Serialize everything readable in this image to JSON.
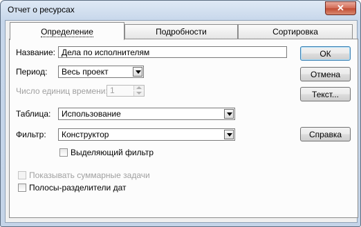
{
  "window": {
    "title": "Отчет о ресурсах",
    "close_glyph": "✕"
  },
  "tabs": [
    {
      "label": "Определение",
      "active": true
    },
    {
      "label": "Подробности",
      "active": false
    },
    {
      "label": "Сортировка",
      "active": false
    }
  ],
  "form": {
    "name_label": "Название:",
    "name_value": "Дела по исполнителям",
    "period_label": "Период:",
    "period_value": "Весь проект",
    "units_label": "Число единиц времени:",
    "units_value": "1",
    "table_label": "Таблица:",
    "table_value": "Использование",
    "filter_label": "Фильтр:",
    "filter_value": "Конструктор",
    "highlight_filter_label": "Выделяющий фильтр",
    "highlight_filter_checked": false,
    "show_summary_label": "Показывать суммарные задачи",
    "show_summary_checked": false,
    "gridlines_label": "Полосы-разделители дат",
    "gridlines_checked": false
  },
  "buttons": {
    "ok": "ОК",
    "cancel": "Отмена",
    "text": "Текст...",
    "help": "Справка"
  }
}
